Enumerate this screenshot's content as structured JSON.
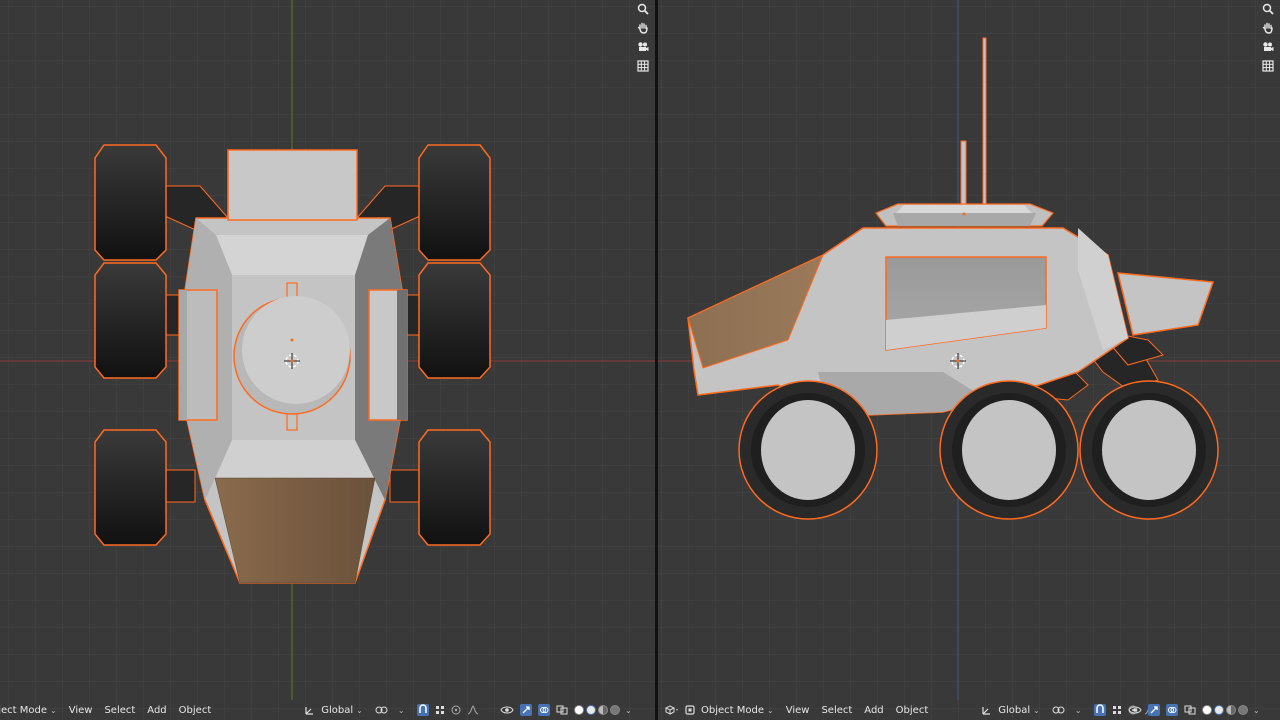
{
  "left_viewport": {
    "header": {
      "mode_label": "Object Mode",
      "menu": [
        "View",
        "Select",
        "Add",
        "Object"
      ],
      "orientation_label": "Global"
    }
  },
  "right_viewport": {
    "header": {
      "mode_label": "Object Mode",
      "menu": [
        "View",
        "Select",
        "Add",
        "Object"
      ],
      "orientation_label": "Global"
    }
  },
  "navigation_icons": [
    "zoom-icon",
    "hand-pan-icon",
    "camera-icon",
    "grid-icon"
  ],
  "colors": {
    "background": "#393939",
    "grid_minor": "#444444",
    "grid_major": "#4c4c4c",
    "x_axis": "#8a3b3b",
    "y_axis": "#5a7a2a",
    "z_axis": "#3a5a8a",
    "selection_outline": "#ff6a1f",
    "body_grey": "#c4c4c4",
    "tire_dark": "#2a2a2a",
    "accent_brown": "#8d6f52"
  }
}
